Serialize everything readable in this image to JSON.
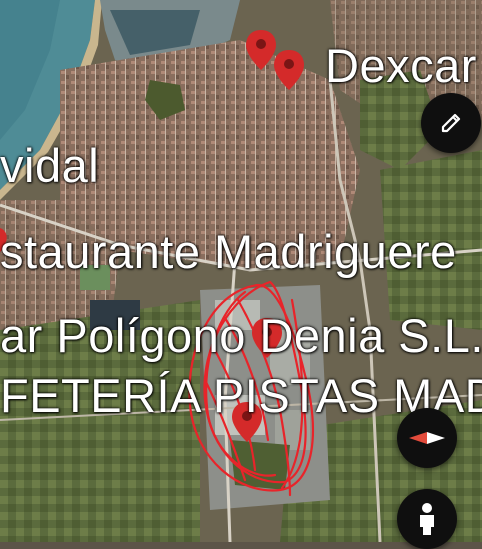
{
  "map": {
    "labels": {
      "dexcar": "Dexcar",
      "vidal": "vidal",
      "restaurante": "staurante Madriguere",
      "poligono": "ar Polígono Denia S.L.",
      "cafeteria": "FETERÍA PISTAS MAD"
    },
    "marker_color": "#d42a2a",
    "annotation_color": "#e8242a",
    "controls": {
      "edit_icon": "pencil-icon",
      "compass_icon": "compass-icon",
      "street_view_icon": "pegman-icon"
    }
  }
}
